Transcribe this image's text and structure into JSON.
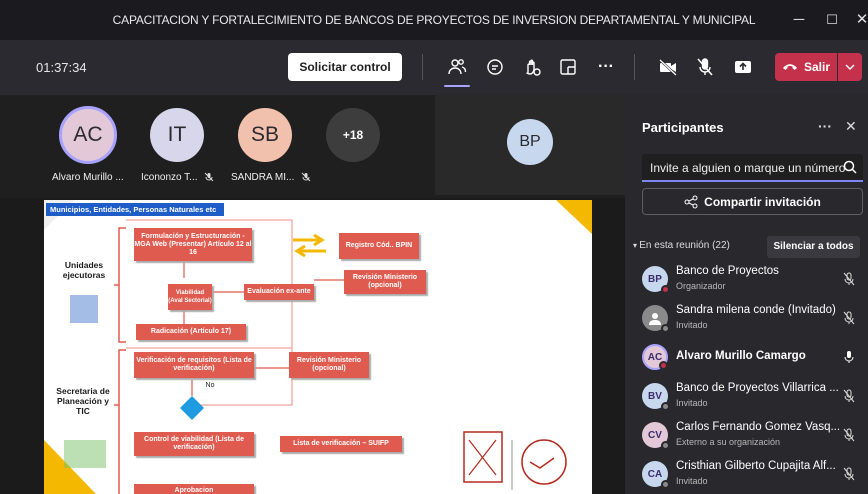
{
  "window": {
    "title": "CAPACITACION Y FORTALECIMIENTO DE BANCOS DE PROYECTOS DE INVERSION DEPARTAMENTAL Y MUNICIPAL",
    "minimize_icon": "minimize-icon",
    "maximize_icon": "maximize-icon",
    "close_icon": "close-icon"
  },
  "toolbar": {
    "timer": "01:37:34",
    "request_control_label": "Solicitar control",
    "leave_label": "Salir",
    "accent_color": "#a7a2ff",
    "leave_color": "#c4314b"
  },
  "participants_strip": [
    {
      "initials": "AC",
      "name": "Alvaro Murillo ...",
      "color": "#e3c8d8"
    },
    {
      "initials": "IT",
      "name": "Icononzo T...",
      "color": "#d7d6ea"
    },
    {
      "initials": "SB",
      "name": "SANDRA MI...",
      "color": "#f2c1ad"
    },
    {
      "initials": "+18",
      "name": "",
      "color": "#3d3d3d"
    }
  ],
  "main_tile": {
    "initials": "BP",
    "color": "#c7d7ee"
  },
  "slide": {
    "header": "Municipios, Entidades, Personas Naturales etc",
    "groups": {
      "unidades": "Unidades ejecutoras",
      "secretaria": "Secretaria de Planeación y TIC"
    },
    "boxes": {
      "formulacion": "Formulación y Estructuración - MGA Web (Presentar) Artículo 12 al 16",
      "registro": "Registro Cód.. BPIN",
      "evaluacion": "Evaluación ex-ante",
      "revision1": "Revisión Ministerio (opcional)",
      "viabilidad": "Viabilidad (Aval Sectorial)",
      "radicacion": "Radicación (Artículo 17)",
      "verificacion": "Verificación de requisitos (Lista de verificación)",
      "revision2": "Revisión Ministerio (opcional)",
      "no_label": "No",
      "control": "Control de viabilidad (Lista de verificación)",
      "lista": "Lista de verificación – SUIFP",
      "aprobacion": "Aprobacion"
    }
  },
  "panel": {
    "title": "Participantes",
    "more_icon": "more-icon",
    "close_icon": "close-icon",
    "invite_placeholder": "Invite a alguien o marque un número",
    "share_label": "Compartir invitación",
    "in_meeting_label": "En esta reunión (22)",
    "mute_all_label": "Silenciar a todos",
    "people": [
      {
        "initials": "BP",
        "name": "Banco de Proyectos",
        "role": "Organizador",
        "color": "#c7d7ee",
        "dot": "#c4314b",
        "mic": "muted"
      },
      {
        "initials": "",
        "name": "Sandra milena conde (Invitado)",
        "role": "Invitado",
        "color": "#8a8a8a",
        "dot": "#8a8a8a",
        "mic": "muted"
      },
      {
        "initials": "AC",
        "name": "Alvaro Murillo Camargo",
        "role": "",
        "color": "#e3c8d8",
        "dot": "#c4314b",
        "mic": "on"
      },
      {
        "initials": "BV",
        "name": "Banco de Proyectos Villarrica ...",
        "role": "Invitado",
        "color": "#c7d7ee",
        "dot": "#8a8a8a",
        "mic": "muted"
      },
      {
        "initials": "CV",
        "name": "Carlos Fernando Gomez Vasq...",
        "role": "Externo a su organización",
        "color": "#e3c8d8",
        "dot": "#8a8a8a",
        "mic": "muted"
      },
      {
        "initials": "CA",
        "name": "Cristhian Gilberto Cupajita Alf...",
        "role": "Invitado",
        "color": "#c7d7ee",
        "dot": "#8a8a8a",
        "mic": "muted"
      }
    ]
  }
}
